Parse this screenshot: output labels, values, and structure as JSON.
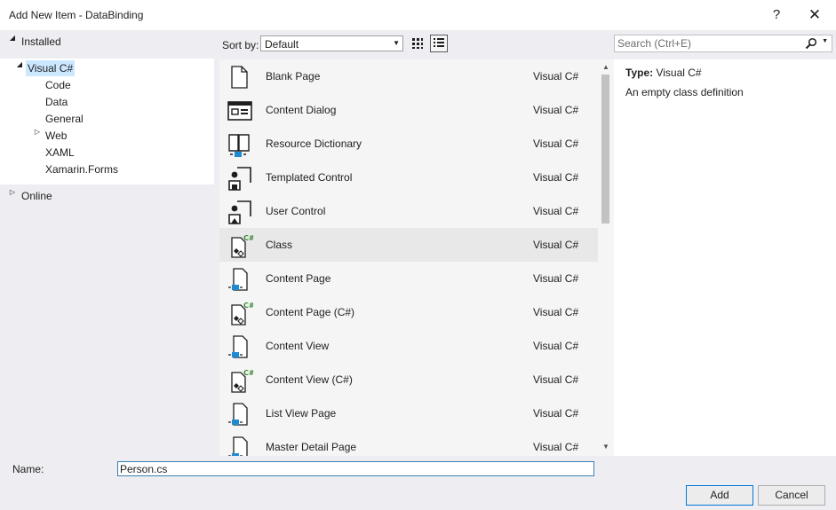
{
  "window": {
    "title": "Add New Item - DataBinding",
    "help_label": "?",
    "close_label": "✕"
  },
  "tree": {
    "installed": "Installed",
    "visual_csharp": "Visual C#",
    "children": [
      "Code",
      "Data",
      "General",
      "Web",
      "XAML",
      "Xamarin.Forms"
    ],
    "online": "Online"
  },
  "toolbar": {
    "sort_label": "Sort by:",
    "sort_value": "Default",
    "search_placeholder": "Search (Ctrl+E)"
  },
  "templates": [
    {
      "name": "Blank Page",
      "lang": "Visual C#",
      "icon": "blank-page-icon"
    },
    {
      "name": "Content Dialog",
      "lang": "Visual C#",
      "icon": "content-dialog-icon"
    },
    {
      "name": "Resource Dictionary",
      "lang": "Visual C#",
      "icon": "resource-dictionary-icon"
    },
    {
      "name": "Templated Control",
      "lang": "Visual C#",
      "icon": "templated-control-icon"
    },
    {
      "name": "User Control",
      "lang": "Visual C#",
      "icon": "user-control-icon"
    },
    {
      "name": "Class",
      "lang": "Visual C#",
      "icon": "class-icon"
    },
    {
      "name": "Content Page",
      "lang": "Visual C#",
      "icon": "content-page-icon"
    },
    {
      "name": "Content Page (C#)",
      "lang": "Visual C#",
      "icon": "content-page-csharp-icon"
    },
    {
      "name": "Content View",
      "lang": "Visual C#",
      "icon": "content-view-icon"
    },
    {
      "name": "Content View (C#)",
      "lang": "Visual C#",
      "icon": "content-view-csharp-icon"
    },
    {
      "name": "List View Page",
      "lang": "Visual C#",
      "icon": "list-view-page-icon"
    },
    {
      "name": "Master Detail Page",
      "lang": "Visual C#",
      "icon": "master-detail-page-icon"
    }
  ],
  "details": {
    "type_label": "Type:",
    "type_value": "Visual C#",
    "description": "An empty class definition"
  },
  "name_field": {
    "label": "Name:",
    "value": "Person.cs"
  },
  "buttons": {
    "add": "Add",
    "cancel": "Cancel"
  },
  "colors": {
    "selection": "#cce8ff",
    "accent_blue": "#1e8ad4",
    "csharp_green": "#388a34"
  }
}
